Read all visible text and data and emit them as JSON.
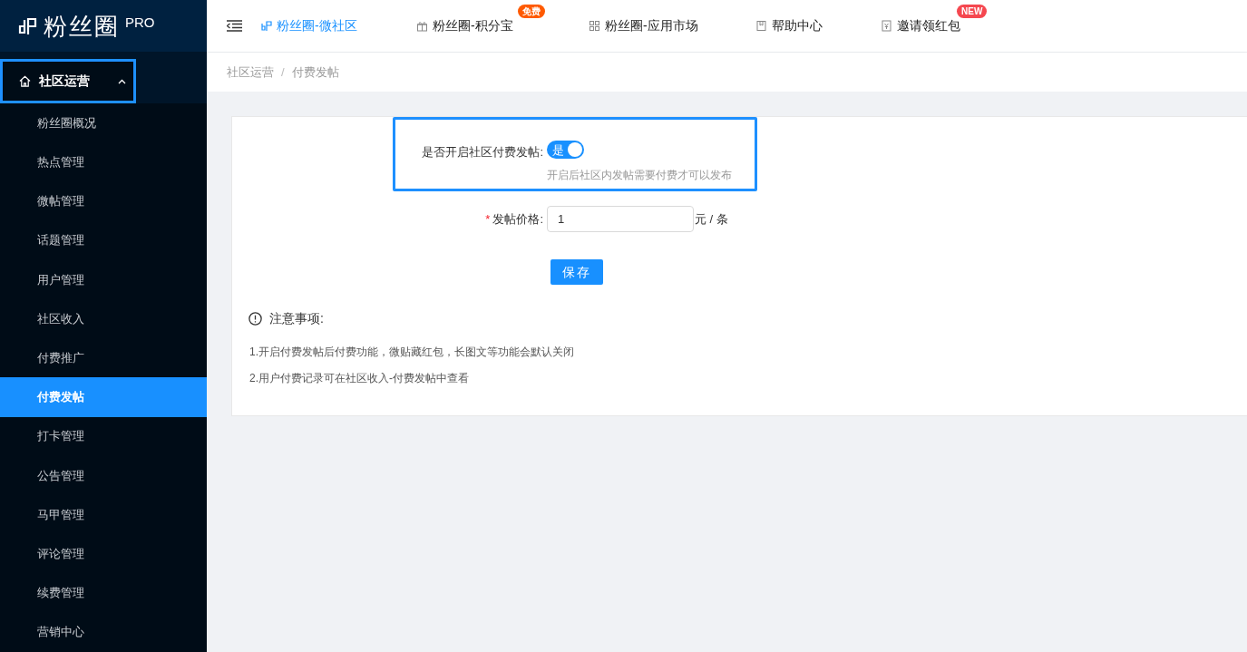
{
  "logo": {
    "text": "粉丝圈",
    "badge": "PRO"
  },
  "sidebar": {
    "group": {
      "label": "社区运营",
      "expanded": true,
      "highlighted": true
    },
    "items": [
      {
        "label": "粉丝圈概况",
        "selected": false
      },
      {
        "label": "热点管理",
        "selected": false
      },
      {
        "label": "微帖管理",
        "selected": false
      },
      {
        "label": "话题管理",
        "selected": false
      },
      {
        "label": "用户管理",
        "selected": false
      },
      {
        "label": "社区收入",
        "selected": false
      },
      {
        "label": "付费推广",
        "selected": false
      },
      {
        "label": "付费发帖",
        "selected": true
      },
      {
        "label": "打卡管理",
        "selected": false
      },
      {
        "label": "公告管理",
        "selected": false
      },
      {
        "label": "马甲管理",
        "selected": false
      },
      {
        "label": "评论管理",
        "selected": false
      },
      {
        "label": "续费管理",
        "selected": false
      },
      {
        "label": "营销中心",
        "selected": false
      }
    ]
  },
  "topnav": [
    {
      "kind": "link",
      "label": "粉丝圈-微社区",
      "selected": true
    },
    {
      "kind": "gift",
      "label": "粉丝圈-积分宝",
      "selected": false,
      "badge": "免费",
      "color": "#ff5a00"
    },
    {
      "kind": "grid",
      "label": "粉丝圈-应用市场",
      "selected": false
    },
    {
      "kind": "book",
      "label": "帮助中心",
      "selected": false
    },
    {
      "kind": "envelope",
      "label": "邀请领红包",
      "selected": false,
      "badge": "NEW",
      "color": "#f5474f"
    }
  ],
  "breadcrumb": {
    "items": [
      "社区运营",
      "付费发帖"
    ],
    "separator": "/"
  },
  "form": {
    "toggle": {
      "label": "是否开启社区付费发帖:",
      "on": true,
      "on_text": "是",
      "hint": "开启后社区内发帖需要付费才可以发布",
      "highlighted": true
    },
    "price": {
      "label": "发帖价格:",
      "required_mark": "*",
      "value": "1",
      "unit": "元 / 条"
    },
    "save": "保存"
  },
  "notice": {
    "title": "注意事项:",
    "lines": [
      "1.开启付费发帖后付费功能，微贴藏红包，长图文等功能会默认关闭",
      "2.用户付费记录可在社区收入-付费发帖中查看"
    ]
  }
}
